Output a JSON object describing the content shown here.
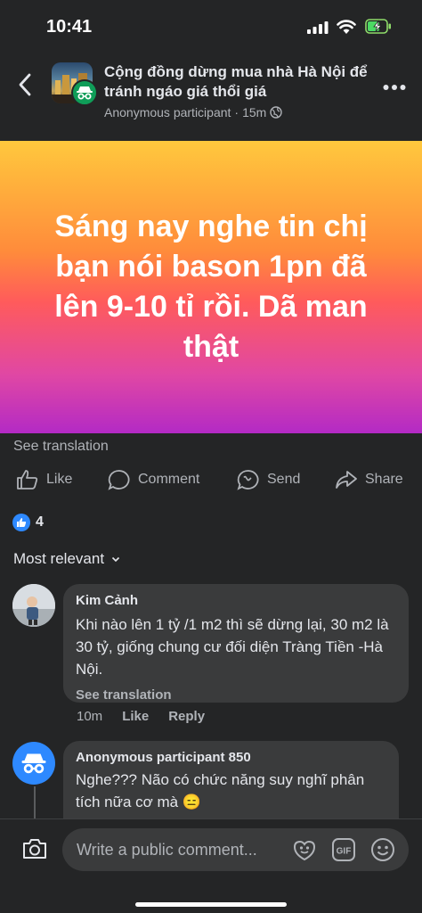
{
  "status": {
    "time": "10:41"
  },
  "header": {
    "group_name": "Cộng đồng dừng mua nhà Hà Nội để tránh ngáo giá thổi giá",
    "author": "Anonymous participant",
    "dot": "·",
    "time": "15m"
  },
  "post": {
    "text": "Sáng nay nghe tin chị bạn nói bason 1pn đã lên 9-10 tỉ rồi. Dã man thật",
    "see_translation": "See translation"
  },
  "actions": {
    "like": "Like",
    "comment": "Comment",
    "send": "Send",
    "share": "Share"
  },
  "reactions": {
    "count": "4"
  },
  "sort": {
    "label": "Most relevant"
  },
  "comments": [
    {
      "name": "Kim Cảnh",
      "text": "Khi nào lên 1 tỷ /1 m2 thì sẽ dừng lại, 30 m2 là 30 tỷ, giống chung cư đối diện Tràng Tiền -Hà Nội.",
      "see_translation": "See translation",
      "time": "10m",
      "like": "Like",
      "reply": "Reply"
    },
    {
      "name": "Anonymous participant 850",
      "text": "Nghe??? Não có chức năng suy nghĩ phân tích nữa cơ mà 😑"
    }
  ],
  "composer": {
    "placeholder": "Write a public comment..."
  },
  "colors": {
    "background": "#242526",
    "bubble": "#3a3b3c",
    "accent": "#2e89ff",
    "anon_badge": "#0f9d58"
  }
}
